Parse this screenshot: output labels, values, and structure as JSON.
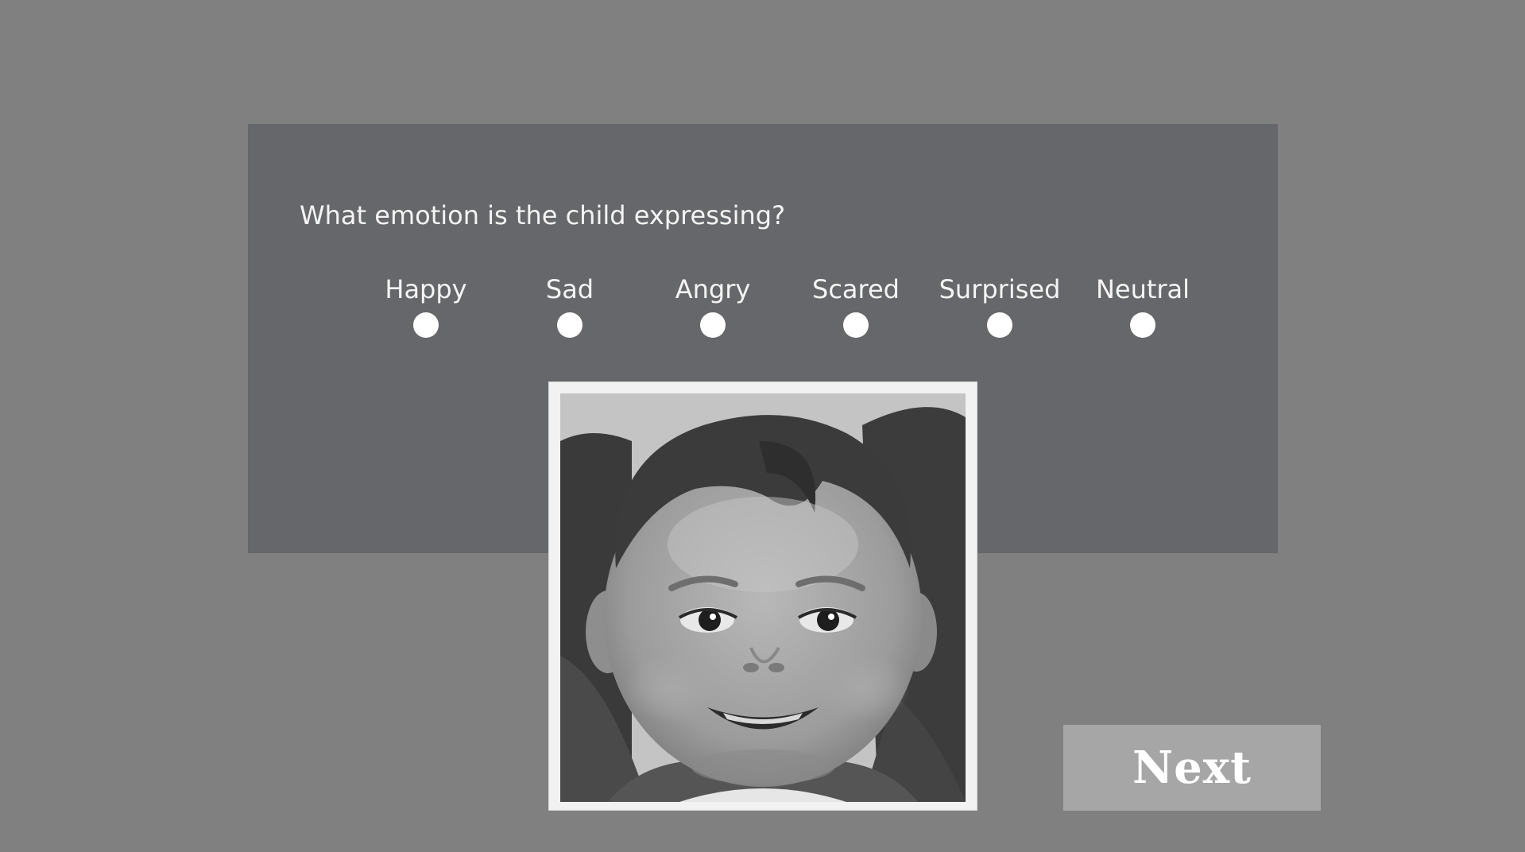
{
  "question": "What emotion is the child expressing?",
  "options": [
    {
      "label": "Happy"
    },
    {
      "label": "Sad"
    },
    {
      "label": "Angry"
    },
    {
      "label": "Scared"
    },
    {
      "label": "Surprised"
    },
    {
      "label": "Neutral"
    }
  ],
  "next_label": "Next",
  "colors": {
    "page_background": "#808080",
    "panel_background": "#66676b",
    "text": "#f4f4f4",
    "radio": "#ffffff",
    "next_button": "#a6a6a6"
  },
  "image": {
    "subject": "grayscale-child-face-photo"
  }
}
